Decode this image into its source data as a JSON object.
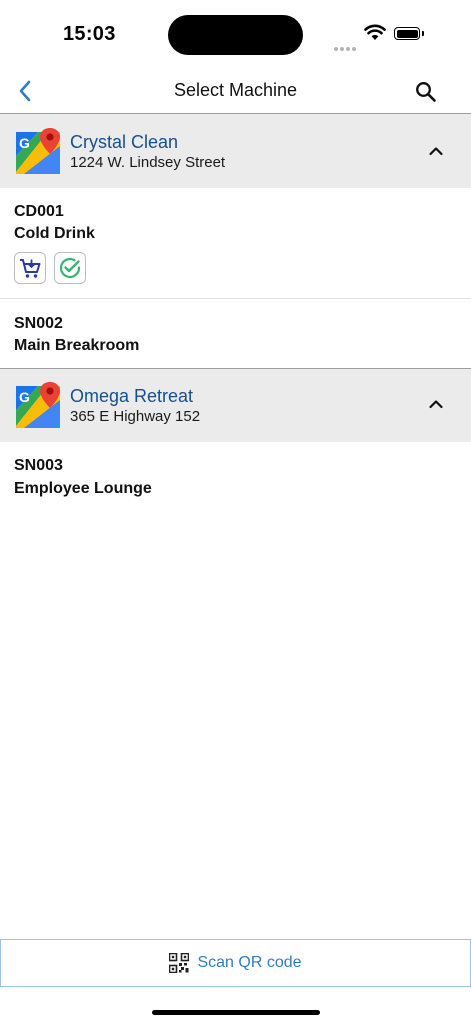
{
  "status_bar": {
    "time": "15:03"
  },
  "nav": {
    "title": "Select Machine"
  },
  "locations": [
    {
      "name": "Crystal Clean",
      "address": "1224 W. Lindsey Street",
      "machines": [
        {
          "id": "CD001",
          "name": "Cold Drink",
          "badges": [
            "cart-icon",
            "check-circle-icon"
          ]
        },
        {
          "id": "SN002",
          "name": "Main Breakroom",
          "badges": []
        }
      ]
    },
    {
      "name": "Omega Retreat",
      "address": "365 E Highway 152",
      "machines": [
        {
          "id": "SN003",
          "name": "Employee Lounge",
          "badges": []
        }
      ]
    }
  ],
  "bottom": {
    "scan_label": "Scan QR code"
  },
  "colors": {
    "accent": "#2f7dc8",
    "location_name": "#15508f",
    "header_bg": "#ebebeb",
    "check_green": "#3cb371",
    "cart_blue": "#2b3a9e"
  }
}
